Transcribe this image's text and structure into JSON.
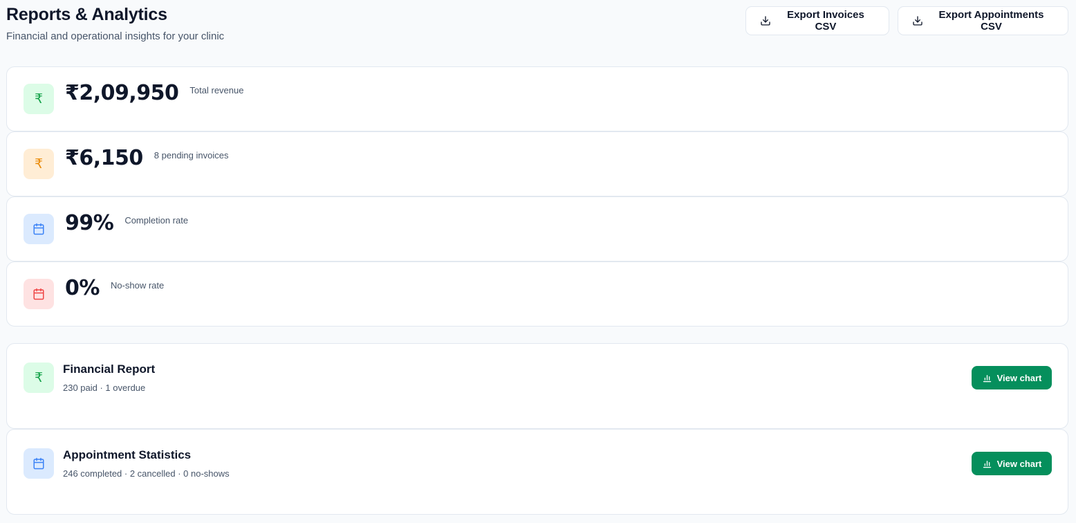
{
  "header": {
    "title": "Reports & Analytics",
    "subtitle": "Financial and operational insights for your clinic"
  },
  "exports": {
    "invoices_label": "Export Invoices CSV",
    "appointments_label": "Export Appointments CSV",
    "icon": "download-icon"
  },
  "stats": [
    {
      "value": "₹2,09,950",
      "label": "Total revenue",
      "icon": "rupee-icon",
      "color": "#16a34a"
    },
    {
      "value": "₹6,150",
      "label": "8 pending invoices",
      "icon": "rupee-icon",
      "color": "#ea8c0c"
    },
    {
      "value": "99%",
      "label": "Completion rate",
      "icon": "calendar-icon",
      "color": "#3b82f6"
    },
    {
      "value": "0%",
      "label": "No-show rate",
      "icon": "calendar-icon",
      "color": "#ef4444"
    }
  ],
  "reports": [
    {
      "title": "Financial Report",
      "subtitle": "230 paid · 1 overdue",
      "button": "View chart",
      "icon": "rupee-icon"
    },
    {
      "title": "Appointment Statistics",
      "subtitle": "246 completed · 2 cancelled · 0 no-shows",
      "button": "View chart",
      "icon": "calendar-icon"
    }
  ],
  "colors": {
    "accent": "#058f5c",
    "background": "#f8fafc",
    "card_border": "#e2e8f0"
  }
}
